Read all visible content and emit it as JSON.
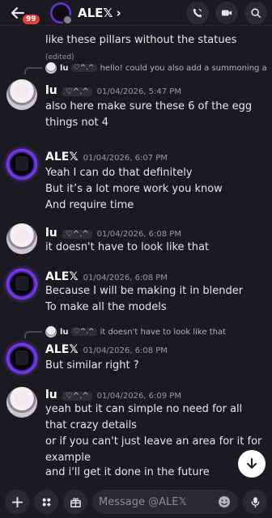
{
  "header": {
    "badge_count": "99",
    "channel_name": "ALE𝕏",
    "chevron": "›",
    "icons": [
      "back-arrow-icon",
      "phone-icon",
      "video-icon",
      "search-icon"
    ]
  },
  "messages": [
    {
      "kind": "continuation",
      "text": "like these pillars without the statues",
      "edited": "(edited)"
    },
    {
      "kind": "message",
      "reply": {
        "name": "lu",
        "tag": "♡^.^",
        "text": "hello! could you also add a summoning area like this? put it anywhere you think is nice and ..."
      },
      "author": "lu",
      "author_tag": "♡^.^",
      "timestamp": "01/04/2026, 5:47 PM",
      "lines": [
        "also here make sure these 6 of the egg things not 4"
      ]
    },
    {
      "kind": "message",
      "author": "ALE𝕏",
      "timestamp": "01/04/2026, 6:07 PM",
      "lines": [
        "Yeah I can do that definitely",
        "But it’s a lot more work you know",
        "And require time"
      ]
    },
    {
      "kind": "message",
      "author": "lu",
      "author_tag": "♡^.^",
      "timestamp": "01/04/2026, 6:08 PM",
      "lines": [
        "it doesn't have to look like that"
      ]
    },
    {
      "kind": "message",
      "author": "ALE𝕏",
      "timestamp": "01/04/2026, 6:08 PM",
      "lines": [
        "Because I will be making it in blender",
        "To make all the models"
      ]
    },
    {
      "kind": "message",
      "reply": {
        "name": "lu",
        "tag": "♡^.^",
        "text": "it doesn't have to look like that"
      },
      "author": "ALE𝕏",
      "timestamp": "01/04/2026, 6:08 PM",
      "lines": [
        "But similar right ?"
      ]
    },
    {
      "kind": "message",
      "author": "lu",
      "author_tag": "♡^.^",
      "timestamp": "01/04/2026, 6:09 PM",
      "lines": [
        "yeah but it can simple no need for all that crazy details",
        "or if you can't just leave an area for it for example",
        "and i'll get it done in the future"
      ]
    }
  ],
  "composer": {
    "placeholder": "Message @ALE𝕏",
    "icons": [
      "plus-icon",
      "apps-icon",
      "gift-icon",
      "emoji-icon",
      "microphone-icon"
    ]
  },
  "colors": {
    "background": "#1b1a20",
    "accent_ring": "#7b3df0",
    "badge": "#e23c3c"
  }
}
